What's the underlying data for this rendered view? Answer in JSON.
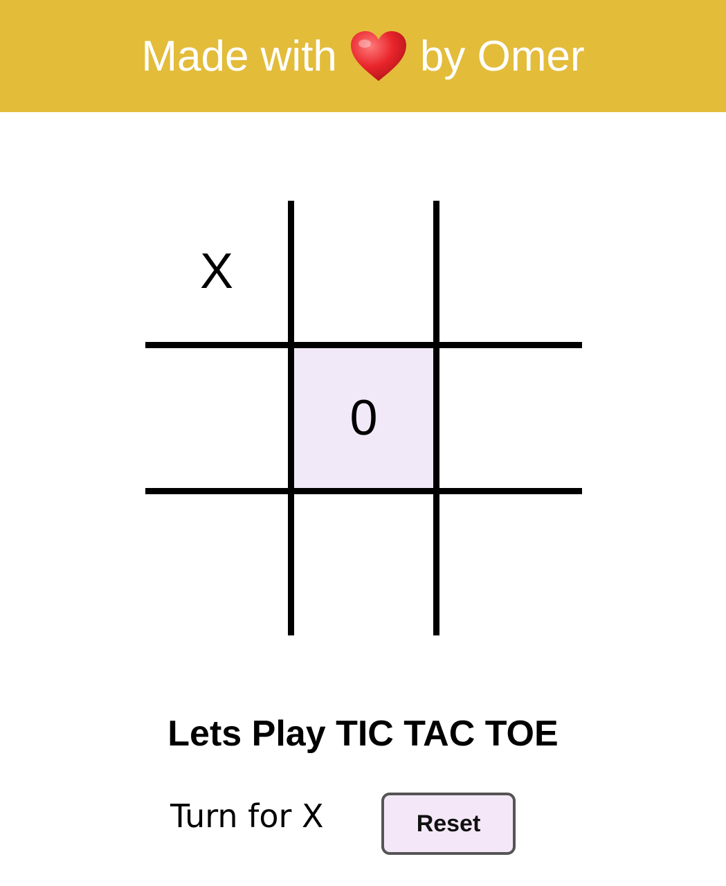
{
  "header": {
    "text_before": "Made with",
    "icon": "heart-icon",
    "text_after": "by Omer",
    "background": "#e3bc3a"
  },
  "board": {
    "cells": [
      "X",
      "",
      "",
      "",
      "0",
      "",
      "",
      "",
      ""
    ],
    "highlighted_cell_index": 4,
    "highlight_color": "#f1e8f8"
  },
  "title": "Lets Play TIC TAC TOE",
  "status": "Turn for X",
  "reset_button_label": "Reset"
}
